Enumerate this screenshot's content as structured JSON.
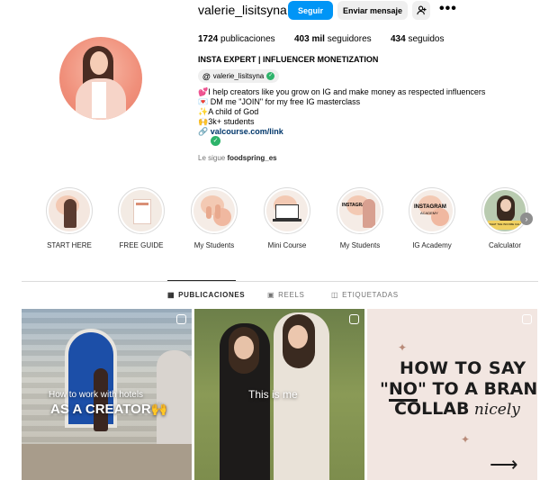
{
  "header": {
    "username": "valerie_lisitsyna",
    "follow_label": "Seguir",
    "message_label": "Enviar mensaje",
    "suggest_icon": "person-add-icon",
    "more_icon": "more-dots-icon"
  },
  "stats": {
    "posts_value": "1724",
    "posts_label": "publicaciones",
    "followers_value": "403 mil",
    "followers_label": "seguidores",
    "following_value": "434",
    "following_label": "seguidos"
  },
  "bio": {
    "category": "INSTA EXPERT | INFLUENCER MONETIZATION",
    "threads_handle": "valerie_lisitsyna",
    "lines": [
      "💕I help creators like you grow on IG and make money as respected influencers",
      "💌 DM me \"JOIN\" for my free IG masterclass",
      "✨A child of God",
      "🙌3k+ students"
    ],
    "link": "valcourse.com/link",
    "followed_by_prefix": "Le sigue",
    "followed_by_user": "foodspring_es"
  },
  "highlights": [
    {
      "label": "START HERE"
    },
    {
      "label": "FREE GUIDE"
    },
    {
      "label": "My Students"
    },
    {
      "label": "Mini Course"
    },
    {
      "label": "My Students"
    },
    {
      "label": "IG Academy"
    },
    {
      "label": "Calculator"
    }
  ],
  "highlight_text": {
    "instagram_1": "INSTAGRAM",
    "instagram_2": "INSTAGRAM",
    "academy": "ACADEMY",
    "calc_caption": "WHAT THE INCOME CALCULATOR"
  },
  "tabs": {
    "posts": "PUBLICACIONES",
    "reels": "REELS",
    "tagged": "ETIQUETADAS"
  },
  "posts": {
    "p1_line1": "How to work with hotels",
    "p1_line2": "AS A CREATOR🙌",
    "p2_caption": "This is me",
    "p3_line1": "HOW TO SAY",
    "p3_quote_open": "\"",
    "p3_no": "NO",
    "p3_quote_close": "\"",
    "p3_line2_rest": " TO A BRAND",
    "p3_line3": "COLLAB",
    "p3_script": " nicely",
    "p3_arrow": "⟶"
  },
  "colors": {
    "primary_button": "#0095f6",
    "secondary_button": "#efefef",
    "verified_badge": "#2db36a",
    "link": "#00376b"
  }
}
